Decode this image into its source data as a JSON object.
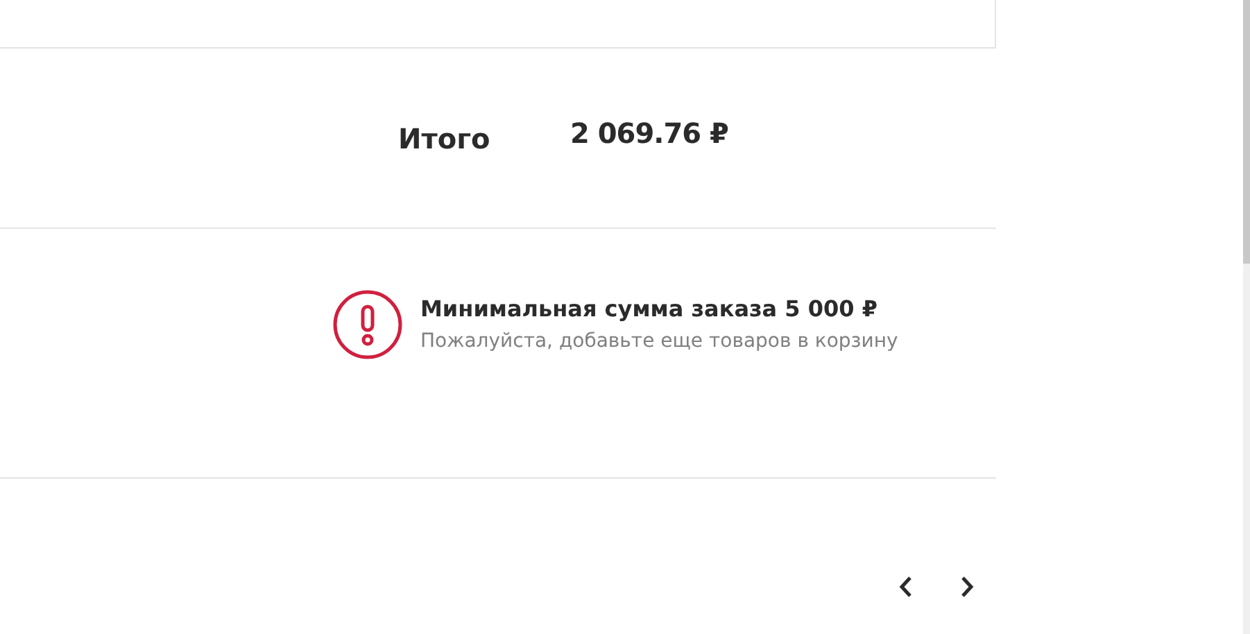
{
  "total": {
    "label": "Итого",
    "value": "2 069.76 ₽"
  },
  "alert": {
    "title": "Минимальная сумма заказа 5 000 ₽",
    "message": "Пожалуйста, добавьте еще товаров в корзину"
  },
  "carousel": {
    "prev_disabled": false,
    "next_disabled": false
  }
}
